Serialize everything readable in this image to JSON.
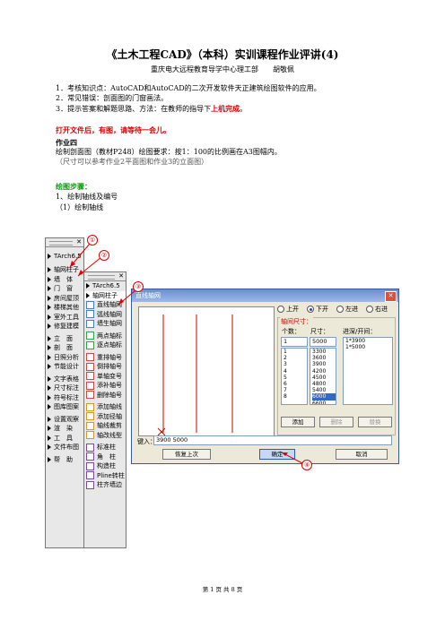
{
  "doc": {
    "title": "《土木工程CAD》（本科）实训课程作业评讲(4)",
    "subtitle": "重庆电大远程教育导学中心理工部　　胡敬佩",
    "intro": [
      "1．考核知识点：AutoCAD和AutoCAD的二次开发软件天正建筑绘图软件的应用。",
      "2．常见错误：剖面图的门窗画法。",
      "3．提示答案和解题思路、方法：在教师的指导下"
    ],
    "intro_red": "上机完成",
    "intro_end": "。",
    "open_note": "打开文件后，有图，请等待一会儿。",
    "task_heading": "作业四",
    "task_text": "绘制剖面图（教材P248）绘图要求：按1：100的比例画在A3图幅内。",
    "task_note": "（尺寸可以参考作业2平面图和作业3的立面图）",
    "steps_heading": "绘图步骤：",
    "step1": "1、绘制轴线及编号",
    "step1_1": "（1）绘制轴线",
    "footer": "第 1 页 共 8 页"
  },
  "menu1": {
    "title": "TArch6.5",
    "items": [
      {
        "label": "轴网柱子",
        "icon": "triangle"
      },
      {
        "label": "墙　体",
        "icon": "triangle"
      },
      {
        "label": "门　窗",
        "icon": "triangle"
      },
      {
        "label": "房间屋顶",
        "icon": "triangle"
      },
      {
        "label": "楼梯其他",
        "icon": "triangle"
      },
      {
        "label": "室外工具",
        "icon": "triangle"
      },
      {
        "label": "修复建模",
        "icon": "triangle"
      },
      {
        "label": "立　面",
        "icon": "triangle"
      },
      {
        "label": "剖　面",
        "icon": "triangle"
      },
      {
        "label": "日照分析",
        "icon": "triangle"
      },
      {
        "label": "节能设计",
        "icon": "triangle"
      },
      {
        "label": "文字表格",
        "icon": "triangle"
      },
      {
        "label": "尺寸标注",
        "icon": "triangle"
      },
      {
        "label": "符号标注",
        "icon": "triangle"
      },
      {
        "label": "图库图案",
        "icon": "triangle"
      },
      {
        "label": "设置观察",
        "icon": "triangle"
      },
      {
        "label": "渲　染",
        "icon": "triangle"
      },
      {
        "label": "工　具",
        "icon": "triangle"
      },
      {
        "label": "文件布图",
        "icon": "triangle"
      },
      {
        "label": "帮　助",
        "icon": "triangle"
      }
    ]
  },
  "menu2": {
    "title": "TArch6.5",
    "header_item": "轴网柱子",
    "items": [
      "直线轴网",
      "弧线轴网",
      "墙生轴网",
      "两点轴标",
      "逐点轴标",
      "重排轴号",
      "倒排轴号",
      "单轴变号",
      "添补轴号",
      "删除轴号",
      "添加轴线",
      "添加径轴",
      "轴线裁剪",
      "轴改线型",
      "标准柱",
      "角　柱",
      "构造柱",
      "Pline转柱",
      "柱齐墙边"
    ]
  },
  "dialog": {
    "title": "直线轴网",
    "radios": [
      "上开",
      "下开",
      "左进",
      "右进"
    ],
    "selected_radio": "下开",
    "group_label": "轴间尺寸：",
    "col_count": "个数：",
    "col_size": "尺寸：",
    "col_span": "进深/开间：",
    "count_value": "1",
    "size_value": "5000",
    "count_list": [
      "1",
      "2",
      "3",
      "4",
      "5",
      "6",
      "7",
      "8"
    ],
    "size_list": [
      "3300",
      "3600",
      "3900",
      "4200",
      "4500",
      "4800",
      "5400",
      "6000",
      "6600"
    ],
    "size_selected": "6000",
    "span_list": [
      "1*3900",
      "1*5000"
    ],
    "btn_add": "添加",
    "btn_delete": "删除",
    "btn_replace": "替换",
    "input_label": "键入：",
    "input_value": "3900 5000",
    "btn_restore": "恢复上次",
    "btn_ok": "确定",
    "btn_cancel": "取消"
  },
  "callouts": [
    "①",
    "②",
    "③",
    "④"
  ],
  "colors": {
    "accent_red": "#e00000",
    "step_green": "#119911"
  }
}
